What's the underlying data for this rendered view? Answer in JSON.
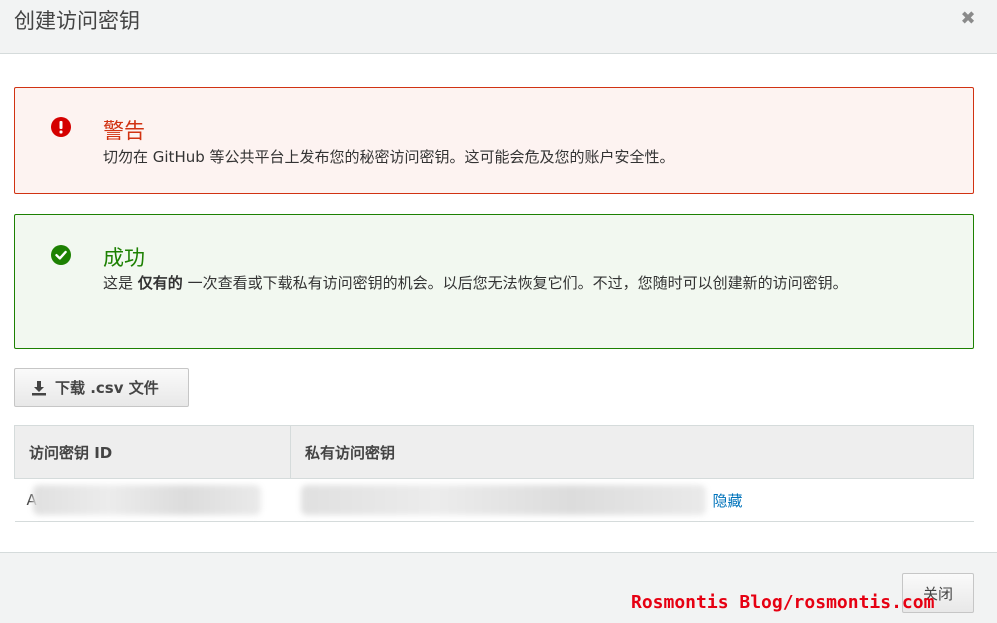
{
  "dialog": {
    "title": "创建访问密钥",
    "close_glyph": "✖"
  },
  "warning": {
    "heading": "警告",
    "body": "切勿在 GitHub 等公共平台上发布您的秘密访问密钥。这可能会危及您的账户安全性。",
    "icon": "exclamation-circle-icon",
    "color": "#d13212"
  },
  "success": {
    "heading": "成功",
    "body_before": "这是 ",
    "body_bold": "仅有的",
    "body_after": " 一次查看或下载私有访问密钥的机会。以后您无法恢复它们。不过，您随时可以创建新的访问密钥。",
    "icon": "check-circle-icon",
    "color": "#1d8102"
  },
  "download": {
    "label": "下载 .csv 文件",
    "icon": "download-icon"
  },
  "table": {
    "headers": [
      "访问密钥 ID",
      "私有访问密钥"
    ],
    "row": {
      "access_key_prefix": "A",
      "hide_link": "隐藏"
    }
  },
  "footer": {
    "close_label": "关闭"
  },
  "watermark": "Rosmontis Blog/rosmontis.com"
}
